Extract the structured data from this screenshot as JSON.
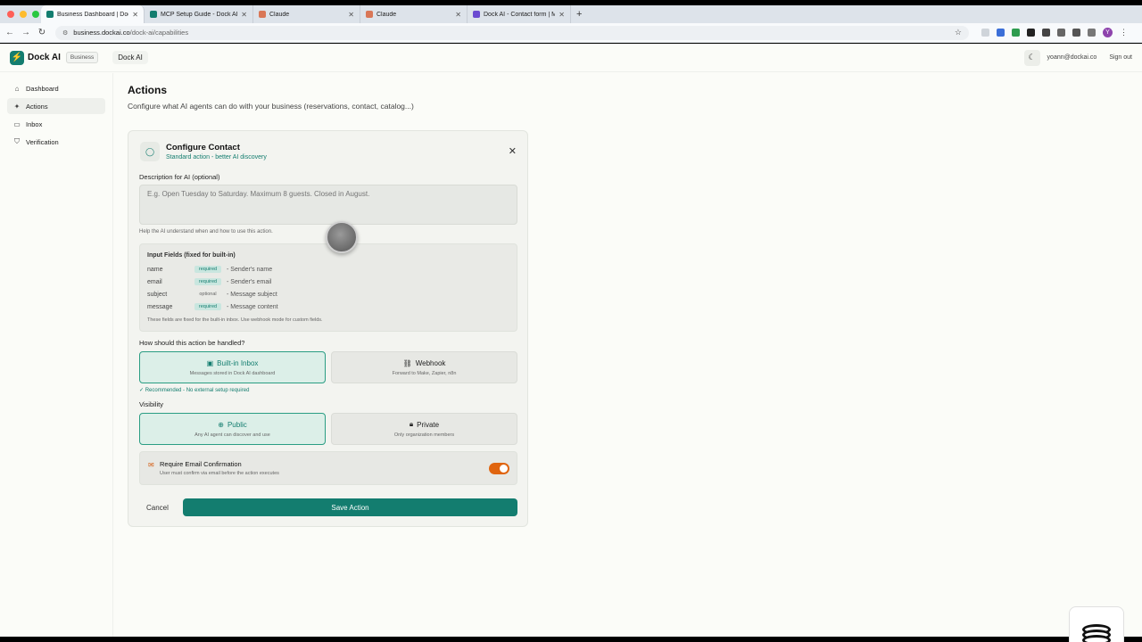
{
  "browser": {
    "tabs": [
      {
        "title": "Business Dashboard | Dock AI",
        "active": true,
        "color": "#137d6f"
      },
      {
        "title": "MCP Setup Guide - Dock AI",
        "active": false,
        "color": "#137d6f"
      },
      {
        "title": "Claude",
        "active": false,
        "color": "#d97757"
      },
      {
        "title": "Claude",
        "active": false,
        "color": "#d97757"
      },
      {
        "title": "Dock AI - Contact form | Mon",
        "active": false,
        "color": "#6b4bd1"
      }
    ],
    "url_host": "business.dockai.co",
    "url_path": "/dock-ai/capabilities"
  },
  "header": {
    "brand": "Dock AI",
    "plan_badge": "Business",
    "workspace": "Dock AI",
    "user_email": "yoann@dockai.co",
    "signout": "Sign out"
  },
  "sidebar": {
    "items": [
      {
        "label": "Dashboard",
        "icon": "home-icon"
      },
      {
        "label": "Actions",
        "icon": "sparkle-icon"
      },
      {
        "label": "Inbox",
        "icon": "inbox-icon"
      },
      {
        "label": "Verification",
        "icon": "shield-icon"
      }
    ],
    "active": "Actions"
  },
  "page": {
    "title": "Actions",
    "subtitle": "Configure what AI agents can do with your business (reservations, contact, catalog...)"
  },
  "card": {
    "title": "Configure Contact",
    "subtitle": "Standard action - better AI discovery",
    "description_label": "Description for AI (optional)",
    "description_placeholder": "E.g. Open Tuesday to Saturday. Maximum 8 guests. Closed in August.",
    "description_hint": "Help the AI understand when and how to use this action.",
    "fields_title": "Input Fields (fixed for built-in)",
    "fields": [
      {
        "name": "name",
        "tag": "required",
        "desc": "- Sender's name"
      },
      {
        "name": "email",
        "tag": "required",
        "desc": "- Sender's email"
      },
      {
        "name": "subject",
        "tag": "optional",
        "desc": "- Message subject"
      },
      {
        "name": "message",
        "tag": "required",
        "desc": "- Message content"
      }
    ],
    "fields_footer": "These fields are fixed for the built-in inbox. Use webhook mode for custom fields.",
    "handling_label": "How should this action be handled?",
    "handling": {
      "inbox_title": "Built-in Inbox",
      "inbox_desc": "Messages stored in Dock AI dashboard",
      "webhook_title": "Webhook",
      "webhook_desc": "Forward to Make, Zapier, n8n",
      "recommended": "✓ Recommended - No external setup required"
    },
    "visibility_label": "Visibility",
    "visibility": {
      "public_title": "Public",
      "public_desc": "Any AI agent can discover and use",
      "private_title": "Private",
      "private_desc": "Only organization members"
    },
    "email_confirm_title": "Require Email Confirmation",
    "email_confirm_desc": "User must confirm via email before the action executes",
    "email_confirm_on": true,
    "cancel": "Cancel",
    "save": "Save Action"
  },
  "colors": {
    "accent": "#137d6f",
    "toggle_on": "#e0650f"
  }
}
